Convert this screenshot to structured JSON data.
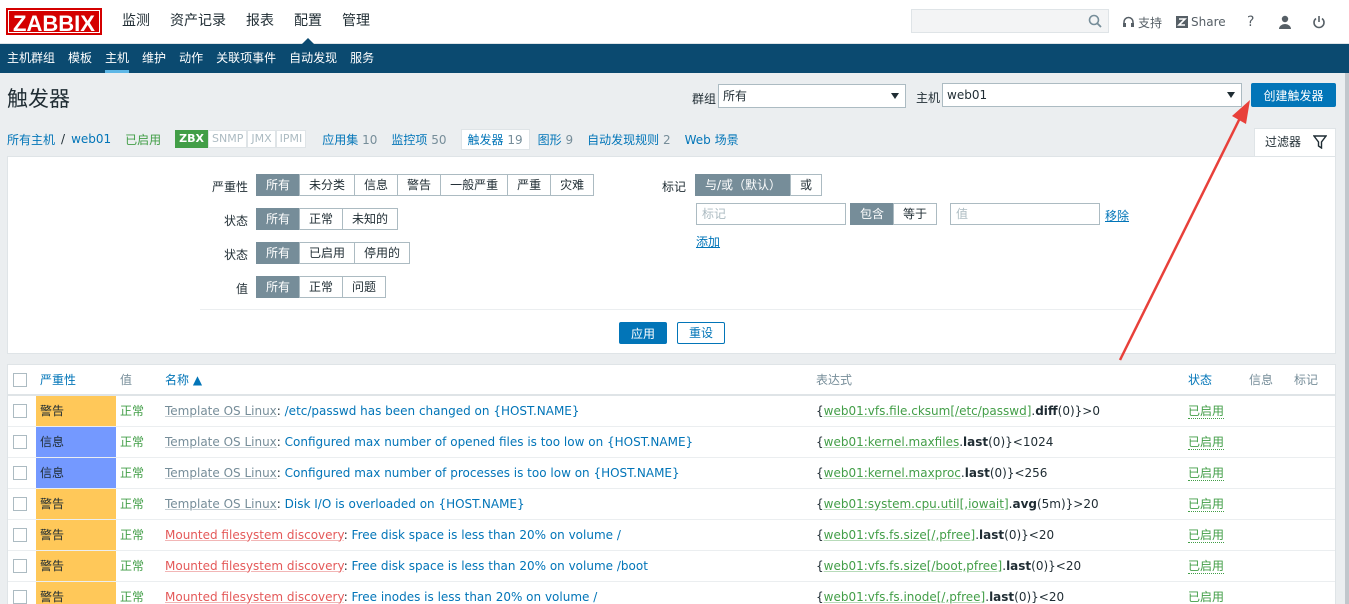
{
  "logo": "ZABBIX",
  "main_nav": [
    "监测",
    "资产记录",
    "报表",
    "配置",
    "管理"
  ],
  "main_nav_active": 3,
  "search": {
    "placeholder": ""
  },
  "top_links": {
    "support": "支持",
    "share": "Share",
    "help": "?"
  },
  "sub_nav": [
    "主机群组",
    "模板",
    "主机",
    "维护",
    "动作",
    "关联项事件",
    "自动发现",
    "服务"
  ],
  "sub_nav_active": 2,
  "page_title": "触发器",
  "group_filter": {
    "label": "群组",
    "value": "所有"
  },
  "host_filter": {
    "label": "主机",
    "value": "web01"
  },
  "create_button": "创建触发器",
  "host_nav": {
    "all_hosts": "所有主机",
    "separator": "/",
    "host": "web01",
    "enabled": "已启用",
    "interfaces": [
      {
        "name": "ZBX",
        "on": true
      },
      {
        "name": "SNMP",
        "on": false
      },
      {
        "name": "JMX",
        "on": false
      },
      {
        "name": "IPMI",
        "on": false
      }
    ],
    "applications": {
      "label": "应用集",
      "count": "10"
    },
    "items": {
      "label": "监控项",
      "count": "50"
    },
    "triggers": {
      "label": "触发器",
      "count": "19"
    },
    "graphs": {
      "label": "图形",
      "count": "9"
    },
    "discovery": {
      "label": "自动发现规则",
      "count": "2"
    },
    "web": {
      "label": "Web 场景"
    }
  },
  "filter_tab": "过滤器",
  "filter": {
    "severity": {
      "label": "严重性",
      "options": [
        "所有",
        "未分类",
        "信息",
        "警告",
        "一般严重",
        "严重",
        "灾难"
      ]
    },
    "state": {
      "label": "状态",
      "options": [
        "所有",
        "正常",
        "未知的"
      ]
    },
    "status": {
      "label": "状态",
      "options": [
        "所有",
        "已启用",
        "停用的"
      ]
    },
    "value": {
      "label": "值",
      "options": [
        "所有",
        "正常",
        "问题"
      ]
    },
    "tags": {
      "label": "标记",
      "options": [
        "与/或（默认）",
        "或"
      ],
      "tag_placeholder": "标记",
      "ops": [
        "包含",
        "等于"
      ],
      "value_placeholder": "值",
      "remove": "移除",
      "add": "添加"
    },
    "apply": "应用",
    "reset": "重设"
  },
  "table": {
    "headers": {
      "severity": "严重性",
      "value": "值",
      "name": "名称 ▲",
      "expression": "表达式",
      "status": "状态",
      "info": "信息",
      "tags": "标记"
    },
    "rows": [
      {
        "severity": "警告",
        "sev_class": "warn",
        "value": "正常",
        "prefix": "Template OS Linux",
        "prefix_type": "tpl",
        "name": "/etc/passwd has been changed on {HOST.NAME}",
        "expr_open": "{",
        "expr_item": "web01:vfs.file.cksum[/etc/passwd]",
        "expr_fn": "diff",
        "expr_rest": "(0)}>0",
        "status": "已启用"
      },
      {
        "severity": "信息",
        "sev_class": "info",
        "value": "正常",
        "prefix": "Template OS Linux",
        "prefix_type": "tpl",
        "name": "Configured max number of opened files is too low on {HOST.NAME}",
        "expr_open": "{",
        "expr_item": "web01:kernel.maxfiles",
        "expr_fn": "last",
        "expr_rest": "(0)}<1024",
        "status": "已启用"
      },
      {
        "severity": "信息",
        "sev_class": "info",
        "value": "正常",
        "prefix": "Template OS Linux",
        "prefix_type": "tpl",
        "name": "Configured max number of processes is too low on {HOST.NAME}",
        "expr_open": "{",
        "expr_item": "web01:kernel.maxproc",
        "expr_fn": "last",
        "expr_rest": "(0)}<256",
        "status": "已启用"
      },
      {
        "severity": "警告",
        "sev_class": "warn",
        "value": "正常",
        "prefix": "Template OS Linux",
        "prefix_type": "tpl",
        "name": "Disk I/O is overloaded on {HOST.NAME}",
        "expr_open": "{",
        "expr_item": "web01:system.cpu.util[,iowait]",
        "expr_fn": "avg",
        "expr_rest": "(5m)}>20",
        "status": "已启用"
      },
      {
        "severity": "警告",
        "sev_class": "warn",
        "value": "正常",
        "prefix": "Mounted filesystem discovery",
        "prefix_type": "lld",
        "name": "Free disk space is less than 20% on volume /",
        "expr_open": "{",
        "expr_item": "web01:vfs.fs.size[/,pfree]",
        "expr_fn": "last",
        "expr_rest": "(0)}<20",
        "status": "已启用"
      },
      {
        "severity": "警告",
        "sev_class": "warn",
        "value": "正常",
        "prefix": "Mounted filesystem discovery",
        "prefix_type": "lld",
        "name": "Free disk space is less than 20% on volume /boot",
        "expr_open": "{",
        "expr_item": "web01:vfs.fs.size[/boot,pfree]",
        "expr_fn": "last",
        "expr_rest": "(0)}<20",
        "status": "已启用"
      },
      {
        "severity": "警告",
        "sev_class": "warn",
        "value": "正常",
        "prefix": "Mounted filesystem discovery",
        "prefix_type": "lld",
        "name": "Free inodes is less than 20% on volume /",
        "expr_open": "{",
        "expr_item": "web01:vfs.fs.inode[/,pfree]",
        "expr_fn": "last",
        "expr_rest": "(0)}<20",
        "status": "已启用"
      }
    ]
  },
  "colors": {
    "brand": "#d40000",
    "subnav": "#0b4a70",
    "primary": "#0275b8",
    "ok": "#429e47",
    "warning": "#ffc859",
    "information": "#7499ff",
    "annotation": "#e8403a"
  }
}
